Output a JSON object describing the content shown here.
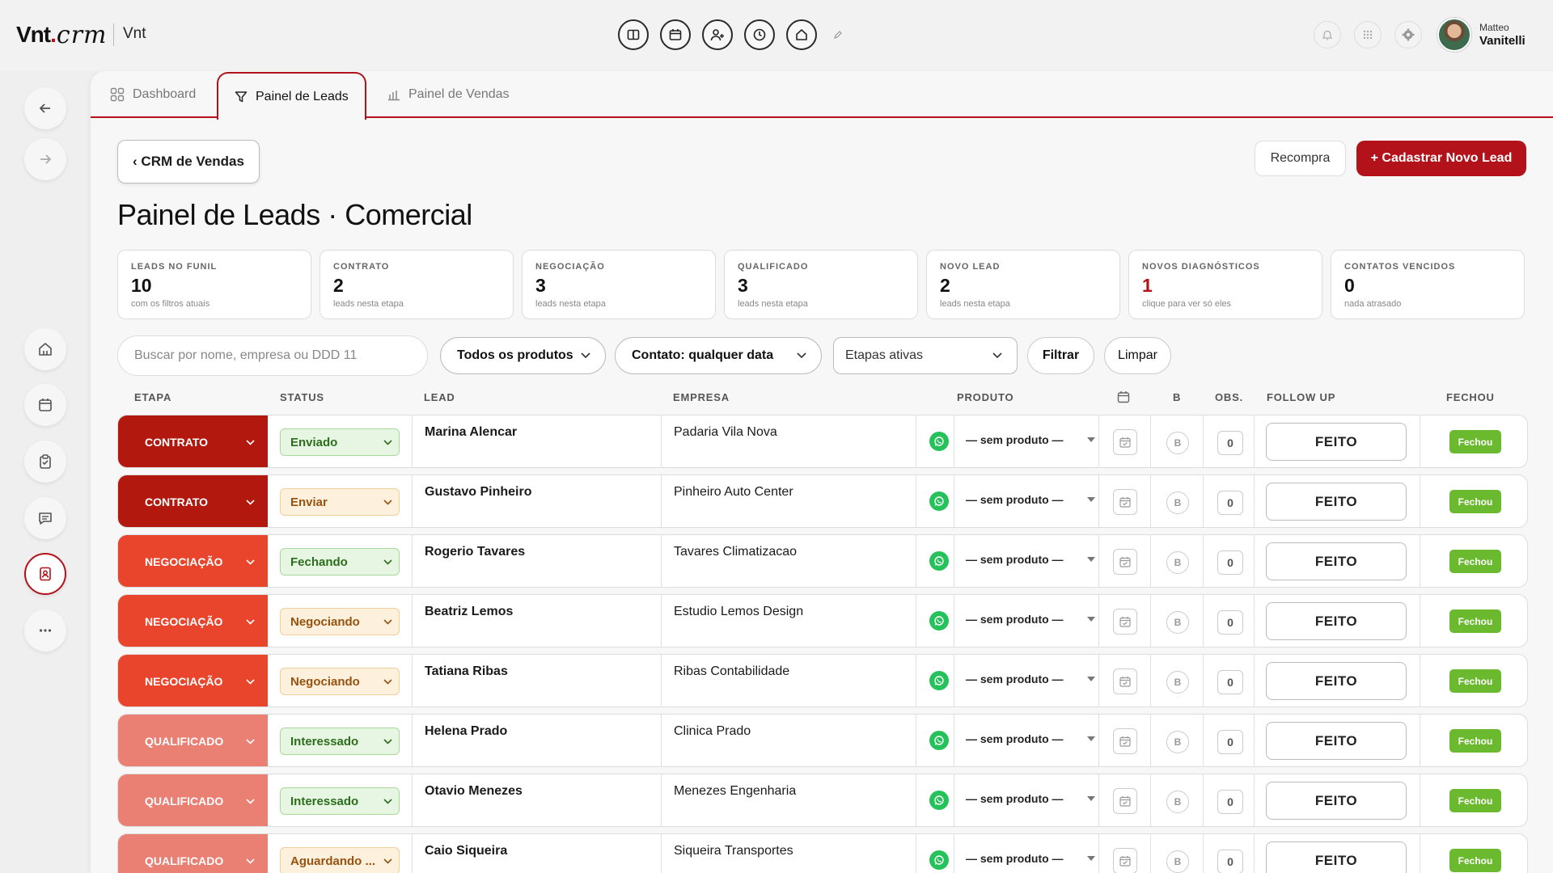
{
  "app": {
    "logo_bold": "Vnt",
    "logo_dot": ".",
    "logo_script": "crm",
    "workspace": "Vnt"
  },
  "toolbar": {
    "icons": [
      "columns-icon",
      "calendar-icon",
      "add-user-icon",
      "clock-icon",
      "home-icon",
      "pencil-icon"
    ]
  },
  "user": {
    "first_name": "Matteo",
    "last_name": "Vanitelli"
  },
  "tabs": [
    {
      "label": "Dashboard",
      "icon": "grid-icon"
    },
    {
      "label": "Painel de Leads",
      "icon": "filter-icon"
    },
    {
      "label": "Painel de Vendas",
      "icon": "bar-chart-icon"
    }
  ],
  "back_button": "‹ CRM de Vendas",
  "page_title": "Painel de Leads · Comercial",
  "actions": {
    "recompra": "Recompra",
    "new_lead": "+ Cadastrar Novo Lead"
  },
  "stats": [
    {
      "label": "LEADS NO FUNIL",
      "value": "10",
      "sub": "com os filtros atuais"
    },
    {
      "label": "CONTRATO",
      "value": "2",
      "sub": "leads nesta etapa"
    },
    {
      "label": "NEGOCIAÇÃO",
      "value": "3",
      "sub": "leads nesta etapa"
    },
    {
      "label": "QUALIFICADO",
      "value": "3",
      "sub": "leads nesta etapa"
    },
    {
      "label": "NOVO LEAD",
      "value": "2",
      "sub": "leads nesta etapa"
    },
    {
      "label": "NOVOS DIAGNÓSTICOS",
      "value": "1",
      "sub": "clique para ver só eles"
    },
    {
      "label": "CONTATOS VENCIDOS",
      "value": "0",
      "sub": "nada atrasado"
    }
  ],
  "filters": {
    "search_placeholder": "Buscar por nome, empresa ou DDD 11",
    "products": "Todos os produtos",
    "contact": "Contato: qualquer data",
    "stages": "Etapas ativas",
    "filter_btn": "Filtrar",
    "clear_btn": "Limpar"
  },
  "columns": {
    "etapa": "ETAPA",
    "status": "STATUS",
    "lead": "LEAD",
    "empresa": "EMPRESA",
    "produto": "PRODUTO",
    "b": "B",
    "obs": "OBS.",
    "follow": "FOLLOW UP",
    "fechou": "FECHOU"
  },
  "stage_colors": {
    "CONTRATO": "#b3180f",
    "NEGOCIAÇÃO": "#e8452c",
    "QUALIFICADO": "#ea7f73"
  },
  "status_colors": {
    "green": {
      "bg": "#e7f6e2",
      "border": "#a9d89c",
      "text": "#2c6d1d"
    },
    "orange": {
      "bg": "#fdf0dc",
      "border": "#efcf9c",
      "text": "#98520f"
    }
  },
  "rows": [
    {
      "stage": "CONTRATO",
      "status": "Enviado",
      "status_tone": "green",
      "lead": "Marina Alencar",
      "empresa": "Padaria Vila Nova",
      "produto": "— sem produto —",
      "b": "B",
      "obs": "0",
      "follow": "FEITO",
      "fechou": "Fechou"
    },
    {
      "stage": "CONTRATO",
      "status": "Enviar",
      "status_tone": "orange",
      "lead": "Gustavo Pinheiro",
      "empresa": "Pinheiro Auto Center",
      "produto": "— sem produto —",
      "b": "B",
      "obs": "0",
      "follow": "FEITO",
      "fechou": "Fechou"
    },
    {
      "stage": "NEGOCIAÇÃO",
      "status": "Fechando",
      "status_tone": "green",
      "lead": "Rogerio Tavares",
      "empresa": "Tavares Climatizacao",
      "produto": "— sem produto —",
      "b": "B",
      "obs": "0",
      "follow": "FEITO",
      "fechou": "Fechou"
    },
    {
      "stage": "NEGOCIAÇÃO",
      "status": "Negociando",
      "status_tone": "orange",
      "lead": "Beatriz Lemos",
      "empresa": "Estudio Lemos Design",
      "produto": "— sem produto —",
      "b": "B",
      "obs": "0",
      "follow": "FEITO",
      "fechou": "Fechou"
    },
    {
      "stage": "NEGOCIAÇÃO",
      "status": "Negociando",
      "status_tone": "orange",
      "lead": "Tatiana Ribas",
      "empresa": "Ribas Contabilidade",
      "produto": "— sem produto —",
      "b": "B",
      "obs": "0",
      "follow": "FEITO",
      "fechou": "Fechou"
    },
    {
      "stage": "QUALIFICADO",
      "status": "Interessado",
      "status_tone": "green",
      "lead": "Helena Prado",
      "empresa": "Clinica Prado",
      "produto": "— sem produto —",
      "b": "B",
      "obs": "0",
      "follow": "FEITO",
      "fechou": "Fechou"
    },
    {
      "stage": "QUALIFICADO",
      "status": "Interessado",
      "status_tone": "green",
      "lead": "Otavio Menezes",
      "empresa": "Menezes Engenharia",
      "produto": "— sem produto —",
      "b": "B",
      "obs": "0",
      "follow": "FEITO",
      "fechou": "Fechou"
    },
    {
      "stage": "QUALIFICADO",
      "status": "Aguardando ...",
      "status_tone": "orange",
      "lead": "Caio Siqueira",
      "empresa": "Siqueira Transportes",
      "produto": "— sem produto —",
      "b": "B",
      "obs": "0",
      "follow": "FEITO",
      "fechou": "Fechou"
    }
  ]
}
